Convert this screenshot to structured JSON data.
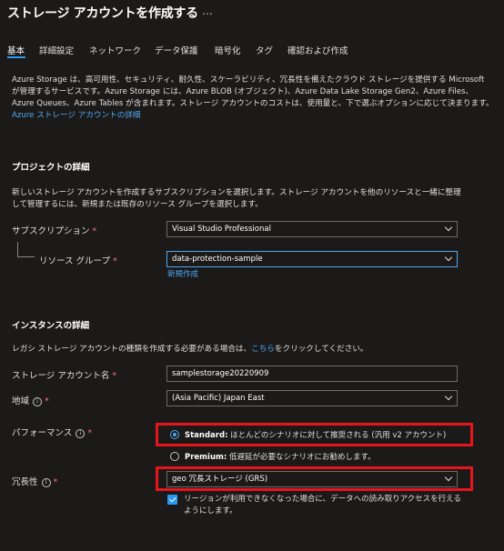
{
  "header": {
    "title": "ストレージ アカウントを作成する",
    "more": "…"
  },
  "tabs": [
    "基本",
    "詳細設定",
    "ネットワーク",
    "データ保護",
    "暗号化",
    "タグ",
    "確認および作成"
  ],
  "intro": {
    "text": "Azure Storage は、高可用性、セキュリティ、耐久性、スケーラビリティ、冗長性を備えたクラウド ストレージを提供する Microsoft が管理するサービスです。Azure Storage には、Azure BLOB (オブジェクト)、Azure Data Lake Storage Gen2、Azure Files、Azure Queues、Azure Tables が含まれます。ストレージ アカウントのコストは、使用量と、下で選ぶオプションに応じて決まります。",
    "link": "Azure ストレージ アカウントの詳細"
  },
  "project": {
    "heading": "プロジェクトの詳細",
    "desc": "新しいストレージ アカウントを作成するサブスクリプションを選択します。ストレージ アカウントを他のリソースと一緒に整理して管理するには、新規または既存のリソース グループを選択します。",
    "subscription_label": "サブスクリプション",
    "subscription_value": "Visual Studio Professional",
    "rg_label": "リソース グループ",
    "rg_value": "data-protection-sample",
    "new_link": "新規作成"
  },
  "instance": {
    "heading": "インスタンスの詳細",
    "desc_prefix": "レガシ ストレージ アカウントの種類を作成する必要がある場合は、",
    "desc_link": "こちら",
    "desc_suffix": "をクリックしてください。",
    "name_label": "ストレージ アカウント名",
    "name_value": "samplestorage20220909",
    "region_label": "地域",
    "region_value": "(Asia Pacific) Japan East",
    "perf_label": "パフォーマンス",
    "perf_standard_bold": "Standard:",
    "perf_standard_text": "ほとんどのシナリオに対して推奨される (汎用 v2 アカウント)",
    "perf_premium_bold": "Premium:",
    "perf_premium_text": "低遅延が必要なシナリオにお勧めします。",
    "redundancy_label": "冗長性",
    "redundancy_value": "geo 冗長ストレージ (GRS)",
    "read_access_text": "リージョンが利用できなくなった場合に、データへの読み取りアクセスを行えるようにします。",
    "read_access_checked": true,
    "required_mark": "*",
    "info_glyph": "i"
  },
  "colors": {
    "accent": "#2899f5",
    "link": "#4fa7f3",
    "highlight_box": "#e8141c",
    "required": "#f1707b"
  }
}
